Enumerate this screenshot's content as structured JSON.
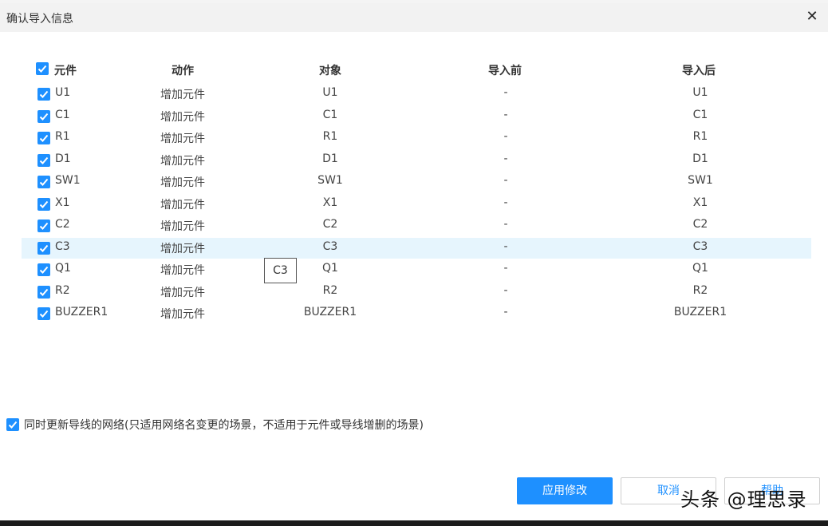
{
  "dialog": {
    "title": "确认导入信息",
    "close_icon": "close-icon"
  },
  "table": {
    "headers": {
      "component": "元件",
      "action": "动作",
      "target": "对象",
      "before": "导入前",
      "after": "导入后"
    },
    "rows": [
      {
        "component": "U1",
        "action": "增加元件",
        "target": "U1",
        "before": "-",
        "after": "U1",
        "checked": true
      },
      {
        "component": "C1",
        "action": "增加元件",
        "target": "C1",
        "before": "-",
        "after": "C1",
        "checked": true
      },
      {
        "component": "R1",
        "action": "增加元件",
        "target": "R1",
        "before": "-",
        "after": "R1",
        "checked": true
      },
      {
        "component": "D1",
        "action": "增加元件",
        "target": "D1",
        "before": "-",
        "after": "D1",
        "checked": true
      },
      {
        "component": "SW1",
        "action": "增加元件",
        "target": "SW1",
        "before": "-",
        "after": "SW1",
        "checked": true
      },
      {
        "component": "X1",
        "action": "增加元件",
        "target": "X1",
        "before": "-",
        "after": "X1",
        "checked": true
      },
      {
        "component": "C2",
        "action": "增加元件",
        "target": "C2",
        "before": "-",
        "after": "C2",
        "checked": true
      },
      {
        "component": "C3",
        "action": "增加元件",
        "target": "C3",
        "before": "-",
        "after": "C3",
        "checked": true,
        "selected": true
      },
      {
        "component": "Q1",
        "action": "增加元件",
        "target": "Q1",
        "before": "-",
        "after": "Q1",
        "checked": true
      },
      {
        "component": "R2",
        "action": "增加元件",
        "target": "R2",
        "before": "-",
        "after": "R2",
        "checked": true
      },
      {
        "component": "BUZZER1",
        "action": "增加元件",
        "target": "BUZZER1",
        "before": "-",
        "after": "BUZZER1",
        "checked": true
      }
    ]
  },
  "tooltip": {
    "text": "C3"
  },
  "options": {
    "sync_nets_label": "同时更新导线的网络(只适用网络名变更的场景，不适用于元件或导线增删的场景)",
    "sync_nets_checked": true
  },
  "buttons": {
    "apply": "应用修改",
    "cancel": "取消",
    "help": "帮助"
  },
  "watermark": "头条 @理思录",
  "colors": {
    "accent": "#1e90ff",
    "selected_row": "#e6f5fd",
    "titlebar": "#f2f2f2"
  }
}
